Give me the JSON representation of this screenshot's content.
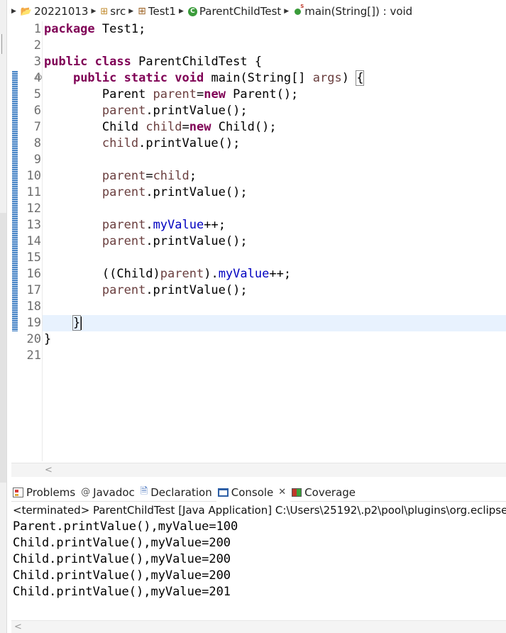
{
  "breadcrumb": {
    "items": [
      {
        "label": "20221013",
        "icon": "project-folder-icon"
      },
      {
        "label": "src",
        "icon": "source-folder-icon"
      },
      {
        "label": "Test1",
        "icon": "package-icon"
      },
      {
        "label": "ParentChildTest",
        "icon": "class-icon"
      },
      {
        "label": "main(String[]) : void",
        "icon": "static-method-icon"
      }
    ]
  },
  "editor": {
    "line_numbers": [
      "1",
      "2",
      "3",
      "4",
      "5",
      "6",
      "7",
      "8",
      "9",
      "10",
      "11",
      "12",
      "13",
      "14",
      "15",
      "16",
      "17",
      "18",
      "19",
      "20",
      "21"
    ],
    "current_line": "19",
    "code": {
      "l1_kw": "package",
      "l1_rest": " Test1;",
      "l3_kw1": "public",
      "l3_kw2": "class",
      "l3_rest": " ParentChildTest {",
      "l4_kw1": "public",
      "l4_kw2": "static",
      "l4_kw3": "void",
      "l4_mid": " main(String[] ",
      "l4_var": "args",
      "l4_close": ") ",
      "l4_brace": "{",
      "l5_a": "Parent ",
      "l5_var": "parent",
      "l5_eq": "=",
      "l5_kw": "new",
      "l5_rest": " Parent();",
      "l6_var": "parent",
      "l6_rest": ".printValue();",
      "l7_a": "Child ",
      "l7_var": "child",
      "l7_eq": "=",
      "l7_kw": "new",
      "l7_rest": " Child();",
      "l8_var": "child",
      "l8_rest": ".printValue();",
      "l10_var1": "parent",
      "l10_eq": "=",
      "l10_var2": "child",
      "l10_semi": ";",
      "l11_var": "parent",
      "l11_rest": ".printValue();",
      "l13_var": "parent",
      "l13_dot": ".",
      "l13_fld": "myValue",
      "l13_rest": "++;",
      "l14_var": "parent",
      "l14_rest": ".printValue();",
      "l16_a": "((Child)",
      "l16_var": "parent",
      "l16_b": ").",
      "l16_fld": "myValue",
      "l16_rest": "++;",
      "l17_var": "parent",
      "l17_rest": ".printValue();",
      "l19_brace": "}",
      "l20_brace": "}"
    }
  },
  "views": {
    "tabs": [
      {
        "label": "Problems",
        "icon": "problems-icon"
      },
      {
        "label": "Javadoc",
        "icon": "javadoc-icon"
      },
      {
        "label": "Declaration",
        "icon": "declaration-icon"
      },
      {
        "label": "Console",
        "icon": "console-icon",
        "active": true
      },
      {
        "label": "Coverage",
        "icon": "coverage-icon"
      }
    ]
  },
  "console": {
    "header": "<terminated> ParentChildTest [Java Application] C:\\Users\\25192\\.p2\\pool\\plugins\\org.eclipse.justj.openjdk",
    "output": [
      "Parent.printValue(),myValue=100",
      "Child.printValue(),myValue=200",
      "Child.printValue(),myValue=200",
      "Child.printValue(),myValue=200",
      "Child.printValue(),myValue=201"
    ]
  }
}
